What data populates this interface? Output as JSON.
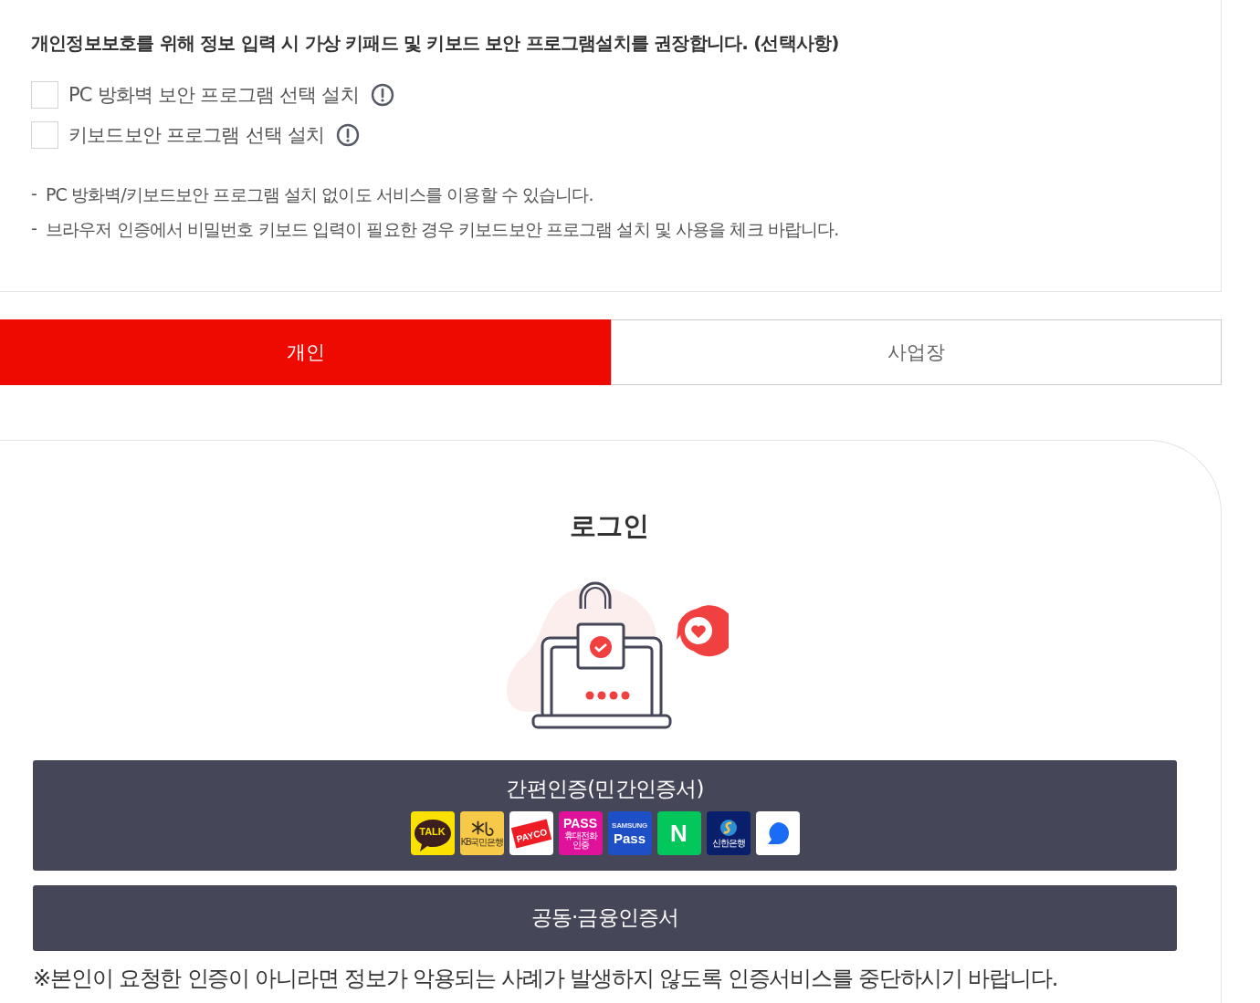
{
  "notice": {
    "title": "개인정보보호를 위해 정보 입력 시 가상 키패드 및 키보드 보안 프로그램설치를 권장합니다. (선택사항)",
    "options": [
      {
        "label": "PC 방화벽 보안 프로그램 선택 설치",
        "checked": false
      },
      {
        "label": "키보드보안 프로그램 선택 설치",
        "checked": false
      }
    ],
    "notes": [
      {
        "bullet": "-",
        "text": "PC 방화벽/키보드보안 프로그램 설치 없이도 서비스를 이용할 수 있습니다."
      },
      {
        "bullet": "-",
        "text": "브라우저 인증에서 비밀번호 키보드 입력이 필요한 경우 키보드보안 프로그램 설치 및 사용을 체크 바랍니다."
      }
    ]
  },
  "tabs": [
    {
      "label": "개인",
      "selected": true
    },
    {
      "label": "사업장",
      "selected": false
    }
  ],
  "login": {
    "title": "로그인",
    "methods": [
      {
        "label": "간편인증(민간인증서)",
        "providers": [
          {
            "kind": "talk",
            "texts": [
              "TALK"
            ]
          },
          {
            "kind": "kb",
            "texts": [
              "KB국민은행"
            ]
          },
          {
            "kind": "payco",
            "texts": [
              "PAYCO"
            ]
          },
          {
            "kind": "pass",
            "texts": [
              "PASS",
              "휴대전화 인증"
            ]
          },
          {
            "kind": "spass",
            "texts": [
              "SAMSUNG",
              "Pass"
            ]
          },
          {
            "kind": "n",
            "texts": [
              "N"
            ]
          },
          {
            "kind": "shinhan",
            "texts": [
              "신한은행"
            ]
          },
          {
            "kind": "bubble"
          }
        ]
      },
      {
        "label": "공동·금융인증서"
      }
    ],
    "warning": "※본인이 요청한 인증이 아니라면 정보가 악용되는 사례가 발생하지 않도록 인증서비스를 중단하시기 바랍니다."
  }
}
